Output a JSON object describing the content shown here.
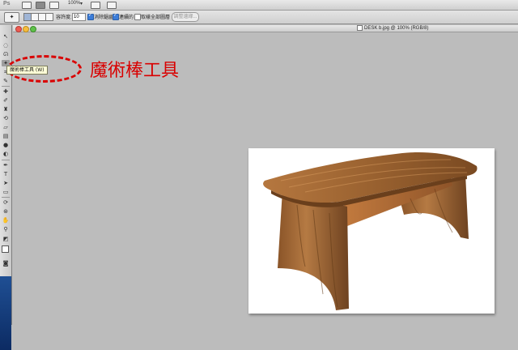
{
  "app_bar": {
    "logo": "Ps",
    "zoom_value": "100%"
  },
  "options_bar": {
    "tool_icon": "magic-wand-icon",
    "tolerance_label": "容許度:",
    "tolerance_value": "10",
    "anti_alias_label": "消除鋸齒",
    "anti_alias_checked": true,
    "contiguous_label": "連續的",
    "contiguous_checked": true,
    "sample_all_layers_label": "取樣全部圖層",
    "sample_all_layers_checked": false,
    "refine_edge_button": "調整邊緣..."
  },
  "document": {
    "title": "DESK b.jpg @ 100% (RGB/8)"
  },
  "tooltip": {
    "text": "魔術棒工具 (W)"
  },
  "annotation": {
    "text": "魔術棒工具",
    "color": "#d90000"
  },
  "colors": {
    "canvas_bg": "#bcbcbc",
    "wood_light": "#b5773f",
    "wood_dark": "#6e4220"
  }
}
